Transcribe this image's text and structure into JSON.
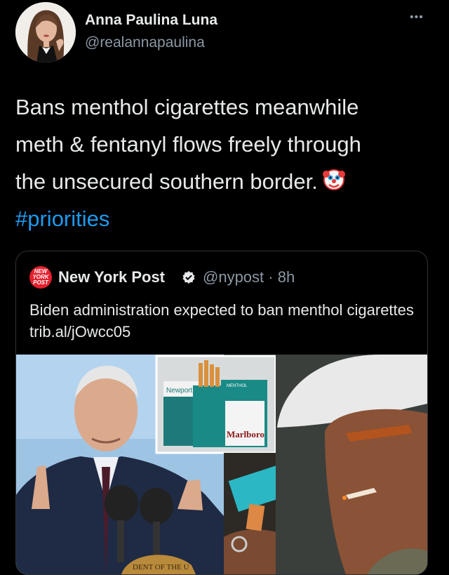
{
  "author": {
    "display_name": "Anna Paulina Luna",
    "handle": "@realannapaulina"
  },
  "more_label": "•••",
  "tweet": {
    "line1": "Bans menthol cigarettes meanwhile",
    "line2": "meth & fentanyl flows freely through",
    "line3": "the unsecured southern border.",
    "hashtag": "#priorities",
    "emoji_icon": "clown-face-icon"
  },
  "quoted": {
    "logo_text": "NEW YORK POST",
    "name": "New York Post",
    "handle": "@nypost",
    "separator": "·",
    "time": "8h",
    "text": "Biden administration expected to ban menthol cigarettes trib.al/jOwcc05",
    "media": {
      "pack_brand_1": "Newport",
      "pack_brand_2": "Marlboro",
      "pack_label": "MENTHOL",
      "seal_text": "DENT OF THE U"
    }
  },
  "colors": {
    "background": "#000000",
    "text": "#e7e9ea",
    "secondary": "#8b98a5",
    "link": "#1d9bf0",
    "border": "#2f3336",
    "verified": "#1d9bf0",
    "nypost_red": "#e5202d"
  }
}
